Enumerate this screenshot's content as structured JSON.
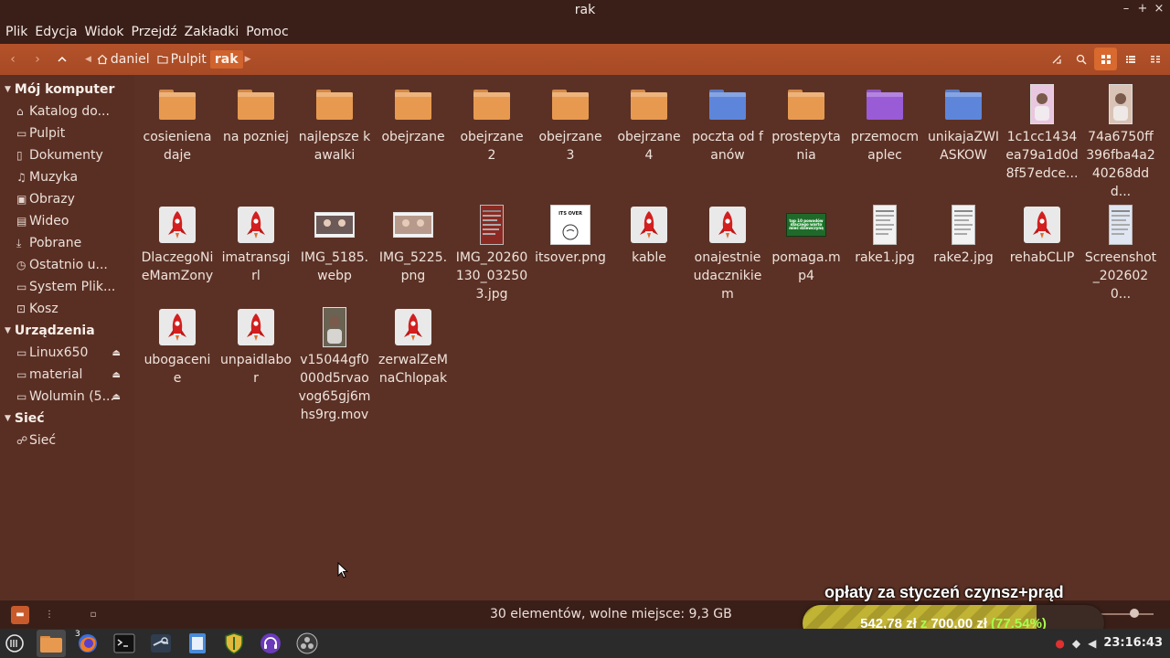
{
  "window": {
    "title": "rak"
  },
  "menu": [
    "Plik",
    "Edycja",
    "Widok",
    "Przejdź",
    "Zakładki",
    "Pomoc"
  ],
  "breadcrumb": [
    {
      "label": "daniel",
      "icon": "home-icon"
    },
    {
      "label": "Pulpit",
      "icon": "folder-icon"
    },
    {
      "label": "rak",
      "current": true
    }
  ],
  "sidebar": {
    "sections": [
      {
        "title": "Mój komputer",
        "items": [
          {
            "label": "Katalog do...",
            "icon": "home-icon"
          },
          {
            "label": "Pulpit",
            "icon": "folder-icon"
          },
          {
            "label": "Dokumenty",
            "icon": "document-icon"
          },
          {
            "label": "Muzyka",
            "icon": "music-icon"
          },
          {
            "label": "Obrazy",
            "icon": "image-icon"
          },
          {
            "label": "Wideo",
            "icon": "video-icon"
          },
          {
            "label": "Pobrane",
            "icon": "download-icon"
          },
          {
            "label": "Ostatnio u...",
            "icon": "clock-icon"
          },
          {
            "label": "System Plik...",
            "icon": "drive-icon"
          },
          {
            "label": "Kosz",
            "icon": "trash-icon"
          }
        ]
      },
      {
        "title": "Urządzenia",
        "items": [
          {
            "label": "Linux650",
            "icon": "drive-icon",
            "eject": true
          },
          {
            "label": "material",
            "icon": "drive-icon",
            "eject": true
          },
          {
            "label": "Wolumin (5...",
            "icon": "drive-icon",
            "eject": true
          }
        ]
      },
      {
        "title": "Sieć",
        "items": [
          {
            "label": "Sieć",
            "icon": "network-icon"
          }
        ]
      }
    ]
  },
  "files": [
    {
      "name": "cosieniena daje",
      "type": "folder",
      "color": "#e79a4f"
    },
    {
      "name": "na pozniej",
      "type": "folder",
      "color": "#e79a4f"
    },
    {
      "name": "najlepsze kawalki",
      "type": "folder",
      "color": "#e79a4f"
    },
    {
      "name": "obejrzane",
      "type": "folder",
      "color": "#e79a4f"
    },
    {
      "name": "obejrzane 2",
      "type": "folder",
      "color": "#e79a4f"
    },
    {
      "name": "obejrzane 3",
      "type": "folder",
      "color": "#e79a4f"
    },
    {
      "name": "obejrzane 4",
      "type": "folder",
      "color": "#e79a4f"
    },
    {
      "name": "poczta od fanów",
      "type": "folder",
      "color": "#5d86db"
    },
    {
      "name": "prostepytania",
      "type": "folder",
      "color": "#e79a4f"
    },
    {
      "name": "przemocmaplec",
      "type": "folder",
      "color": "#9a5bd6"
    },
    {
      "name": "unikajaZWIASKOW",
      "type": "folder",
      "color": "#5d86db"
    },
    {
      "name": "1c1cc1434ea79a1d0d8f57edce...",
      "type": "image-portrait",
      "color": "#e9c7e0"
    },
    {
      "name": "74a6750ff396fba4a240268ddd...",
      "type": "image-portrait",
      "color": "#d9c3b6"
    },
    {
      "name": "DlaczegoNieMamZony",
      "type": "rocket"
    },
    {
      "name": "imatransgirl",
      "type": "rocket"
    },
    {
      "name": "IMG_5185.webp",
      "type": "image-wide",
      "color": "#6b5a58"
    },
    {
      "name": "IMG_5225.png",
      "type": "image-wide",
      "color": "#b89a8c"
    },
    {
      "name": "IMG_20260130_032503.jpg",
      "type": "image-doc",
      "color": "#8a2a22"
    },
    {
      "name": "itsover.png",
      "type": "image-meme",
      "caption": "ITS OVER"
    },
    {
      "name": "kable",
      "type": "rocket"
    },
    {
      "name": "onajestnieudacznikiem",
      "type": "rocket"
    },
    {
      "name": "pomaga.mp4",
      "type": "image-video",
      "color": "#1f6a2a",
      "caption": "top 10 powodów dlaczego warto mieć dziewczynę"
    },
    {
      "name": "rake1.jpg",
      "type": "image-doc",
      "color": "#f2f2f2"
    },
    {
      "name": "rake2.jpg",
      "type": "image-doc",
      "color": "#f2f2f2"
    },
    {
      "name": "rehabCLIP",
      "type": "rocket"
    },
    {
      "name": "Screenshot_2026020...",
      "type": "image-doc",
      "color": "#dfe6f2"
    },
    {
      "name": "ubogacenie",
      "type": "rocket"
    },
    {
      "name": "unpaidlabor",
      "type": "rocket"
    },
    {
      "name": "v15044gf0000d5rvaovog65gj6mhs9rg.mov",
      "type": "image-portrait",
      "color": "#6a6252"
    },
    {
      "name": "zerwalZeMnaChlopak",
      "type": "rocket"
    }
  ],
  "status": {
    "text": "30 elementów, wolne miejsce: 9,3 GB"
  },
  "overlay": {
    "title": "opłaty za styczeń czynsz+prąd",
    "current": "542,78 zł",
    "separator": "z",
    "goal": "700,00 zł",
    "percent_text": "(77.54%)",
    "progress": 0.7754
  },
  "taskbar": {
    "apps": [
      "menu-icon",
      "files-icon",
      "firefox-icon",
      "terminal-icon",
      "steam-icon",
      "document-viewer-icon",
      "shield-icon",
      "headphones-icon",
      "obs-icon"
    ],
    "firefox_badge": "3",
    "clock": "23:16:43"
  },
  "colors": {
    "accent": "#d0632e",
    "background": "#5b3125",
    "toolbar": "#b4522a"
  }
}
